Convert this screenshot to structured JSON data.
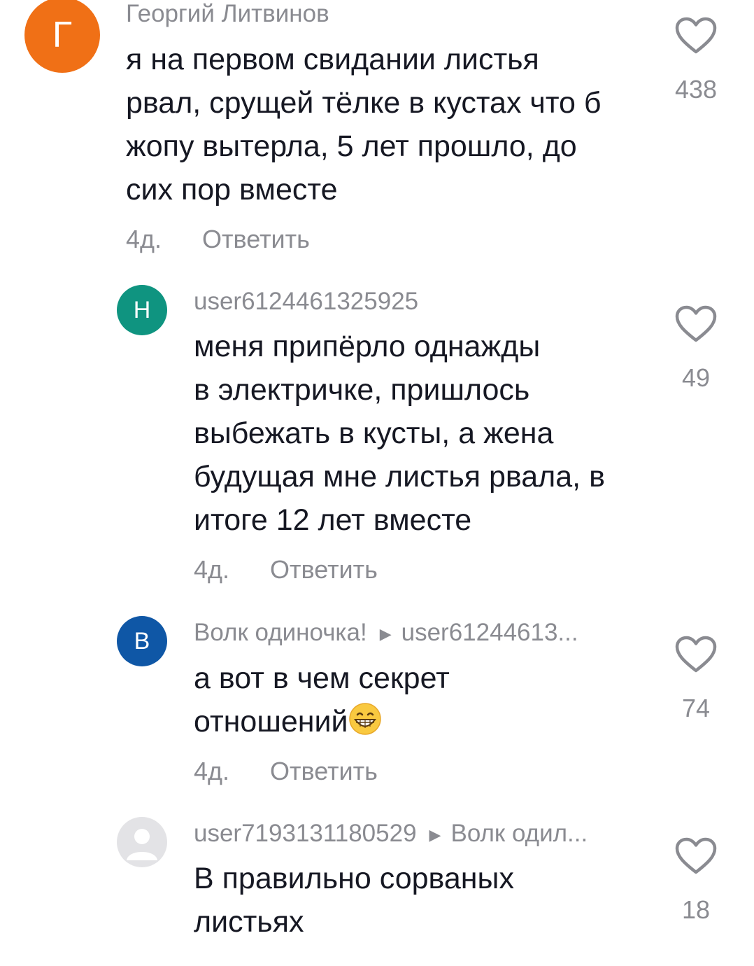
{
  "comments": [
    {
      "avatar_letter": "Г",
      "avatar_color": "#f07016",
      "username": "Георгий Литвинов",
      "lines": [
        "я на первом свидании листья",
        "рвал, срущей тёлке в кустах что б",
        "жопу вытерла, 5 лет прошло, до",
        "сих пор вместе"
      ],
      "age": "4д.",
      "reply_label": "Ответить",
      "likes": "438"
    },
    {
      "avatar_letter": "Н",
      "avatar_color": "#0f9480",
      "username": "user6124461325925",
      "lines": [
        "меня припёрло однажды",
        "в электричке, пришлось",
        "выбежать в кусты, а жена",
        "будущая мне листья рвала, в",
        "итоге 12 лет вместе"
      ],
      "age": "4д.",
      "reply_label": "Ответить",
      "likes": "49"
    },
    {
      "avatar_letter": "В",
      "avatar_color": "#0f57a6",
      "username": "Волк одиночка!",
      "reply_to": "user61244613...",
      "lines": [
        "а вот в чем секрет",
        "отношений"
      ],
      "emoji_icon": "grinning-face-emoji",
      "age": "4д.",
      "reply_label": "Ответить",
      "likes": "74"
    },
    {
      "avatar_icon": "default-user-avatar-icon",
      "avatar_color": "#e3e3e6",
      "username": "user7193131180529",
      "reply_to": "Волк одил...",
      "lines": [
        "В правильно сорваных",
        "листьях"
      ],
      "likes": "18"
    }
  ],
  "icons": {
    "like": "heart-outline-icon",
    "reply_arrow": "play-arrow-icon"
  },
  "colors": {
    "text": "#161823",
    "secondary": "#8a8b91",
    "heart": "#8a8b91"
  }
}
